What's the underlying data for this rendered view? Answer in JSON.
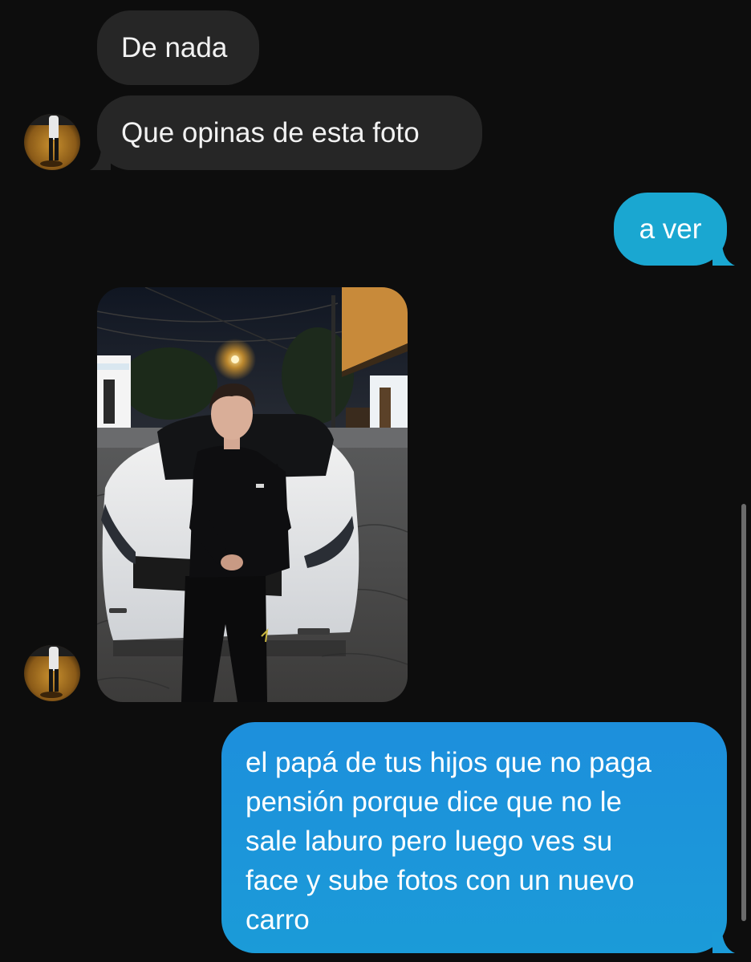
{
  "messages": {
    "m1": {
      "text": "De nada",
      "sender": "contact"
    },
    "m2": {
      "text": "Que opinas de esta foto",
      "sender": "contact"
    },
    "m3": {
      "text": "a ver",
      "sender": "me"
    },
    "m4": {
      "type": "photo",
      "sender": "contact",
      "subject": "young man in black outfit sitting on hood of white sedan at night"
    },
    "m5": {
      "lines": [
        "el papá de tus hijos que no paga",
        "pensión porque dice que no le",
        "sale laburo pero luego ves su",
        "face y sube fotos con un nuevo",
        "carro"
      ],
      "sender": "me"
    }
  },
  "colors": {
    "background": "#0d0d0d",
    "incoming_bubble": "#262626",
    "outgoing_short": "#1aa7d1",
    "outgoing_gradient_top": "#1d8fdc",
    "outgoing_gradient_bottom": "#1ba0d6"
  }
}
